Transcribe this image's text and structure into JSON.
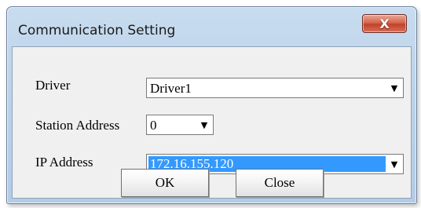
{
  "dialog": {
    "title": "Communication Setting",
    "close_glyph": "X"
  },
  "form": {
    "driver": {
      "label": "Driver",
      "value": "Driver1"
    },
    "station_address": {
      "label": "Station Address",
      "value": "0"
    },
    "ip_address": {
      "label": "IP Address",
      "value": "172.16.155.120"
    }
  },
  "buttons": {
    "ok_label": "OK",
    "close_label": "Close"
  },
  "icons": {
    "dropdown": "chevron-down-icon",
    "close": "close-icon"
  }
}
